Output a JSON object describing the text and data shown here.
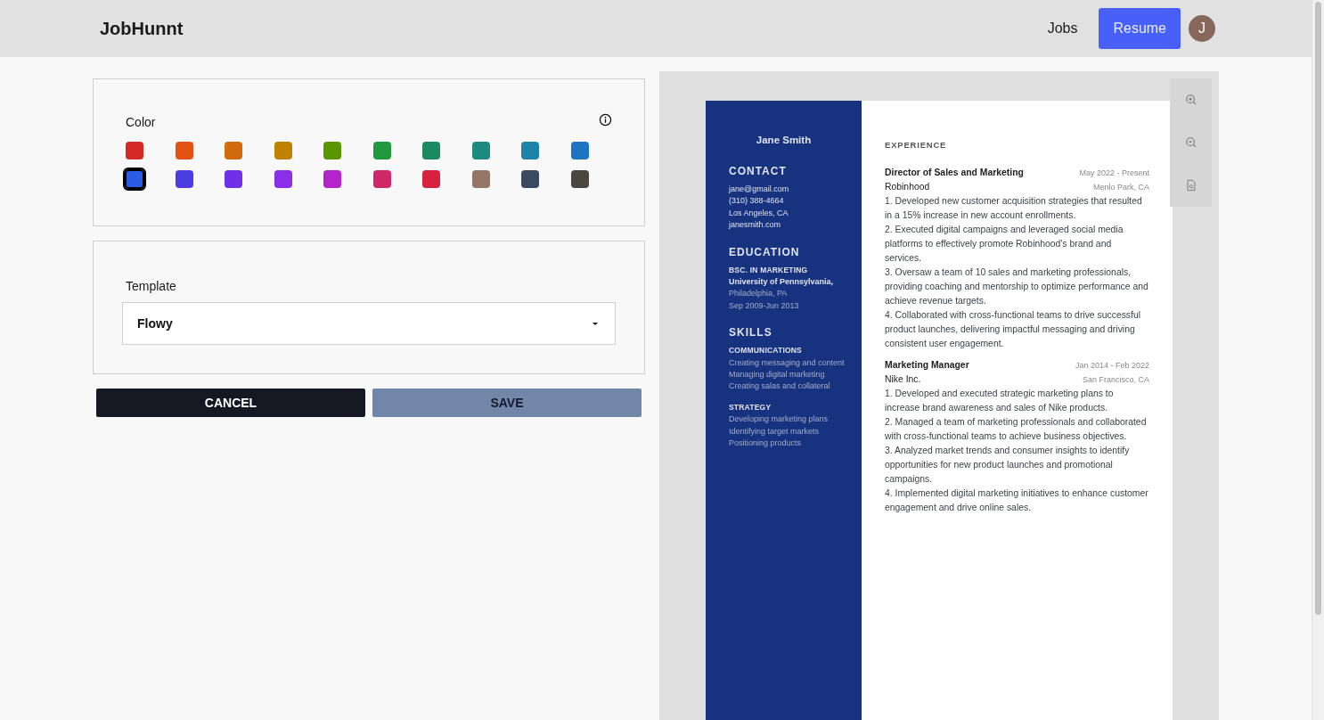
{
  "header": {
    "logo": "JobHunnt",
    "nav": [
      {
        "label": "Jobs",
        "selected": false
      },
      {
        "label": "Resume",
        "selected": true
      }
    ],
    "avatar": "J"
  },
  "color_panel": {
    "label": "Color",
    "colors": [
      {
        "color": "#d42a27",
        "selected": false
      },
      {
        "color": "#e35215",
        "selected": false
      },
      {
        "color": "#d06c0e",
        "selected": false
      },
      {
        "color": "#c08100",
        "selected": false
      },
      {
        "color": "#5a9600",
        "selected": false
      },
      {
        "color": "#219a3e",
        "selected": false
      },
      {
        "color": "#1c8a60",
        "selected": false
      },
      {
        "color": "#1c8a7e",
        "selected": false
      },
      {
        "color": "#1c84a8",
        "selected": false
      },
      {
        "color": "#1c74c3",
        "selected": false
      },
      {
        "color": "#2a5ce6",
        "selected": true
      },
      {
        "color": "#4a3ee0",
        "selected": false
      },
      {
        "color": "#7030e8",
        "selected": false
      },
      {
        "color": "#8a2ee8",
        "selected": false
      },
      {
        "color": "#b424cc",
        "selected": false
      },
      {
        "color": "#d0266a",
        "selected": false
      },
      {
        "color": "#d82040",
        "selected": false
      },
      {
        "color": "#967666",
        "selected": false
      },
      {
        "color": "#3a4a60",
        "selected": false
      },
      {
        "color": "#4a4640",
        "selected": false
      }
    ]
  },
  "template_panel": {
    "label": "Template",
    "value": "Flowy"
  },
  "buttons": {
    "cancel": "CANCEL",
    "save": "SAVE"
  },
  "resume": {
    "name": "Jane Smith",
    "sections": [
      {
        "kind": "contact",
        "title": "CONTACT",
        "lines": [
          "jane@gmail.com",
          "(310) 388-4664",
          "Los Angeles, CA",
          "janesmith.com"
        ]
      },
      {
        "kind": "education",
        "title": "EDUCATION",
        "degree": "BSC. IN MARKETING",
        "school": "University of Pennsylvania,",
        "lines": [
          "Philadelphia, PA",
          "Sep 2009-Jun 2013"
        ]
      },
      {
        "kind": "skills",
        "title": "SKILLS",
        "groups": [
          {
            "title": "COMMUNICATIONS",
            "items": [
              "Creating messaging and content",
              "Managing digital marketing",
              "Creating salas and collateral"
            ]
          },
          {
            "title": "STRATEGY",
            "items": [
              "Developing marketing plans",
              "Identifying target markets",
              "Positioning products"
            ]
          }
        ]
      }
    ],
    "experience_title": "EXPERIENCE",
    "jobs": [
      {
        "title": "Director of Sales and Marketing",
        "dates": "May 2022 - Present",
        "company": "Robinhood",
        "location": "Menlo Park, CA",
        "points": [
          "1. Developed new customer acquisition strategies that resulted in a 15% increase in new account enrollments.",
          "2. Executed digital campaigns and leveraged social media platforms to effectively promote Robinhood's brand and services.",
          "3. Oversaw a team of 10 sales and marketing professionals, providing coaching and mentorship to optimize performance and achieve revenue targets.",
          "4. Collaborated with cross-functional teams to drive successful product launches, delivering impactful messaging and driving consistent user engagement."
        ]
      },
      {
        "title": "Marketing Manager",
        "dates": "Jan 2014 - Feb 2022",
        "company": "Nike Inc.",
        "location": "San Francisco, CA",
        "points": [
          "1. Developed and executed strategic marketing plans to increase brand awareness and sales of Nike products.",
          "2. Managed a team of marketing professionals and collaborated with cross-functional teams to achieve business objectives.",
          "3. Analyzed market trends and consumer insights to identify opportunities for new product launches and promotional campaigns.",
          "4. Implemented digital marketing initiatives to enhance customer engagement and drive online sales."
        ]
      }
    ]
  }
}
